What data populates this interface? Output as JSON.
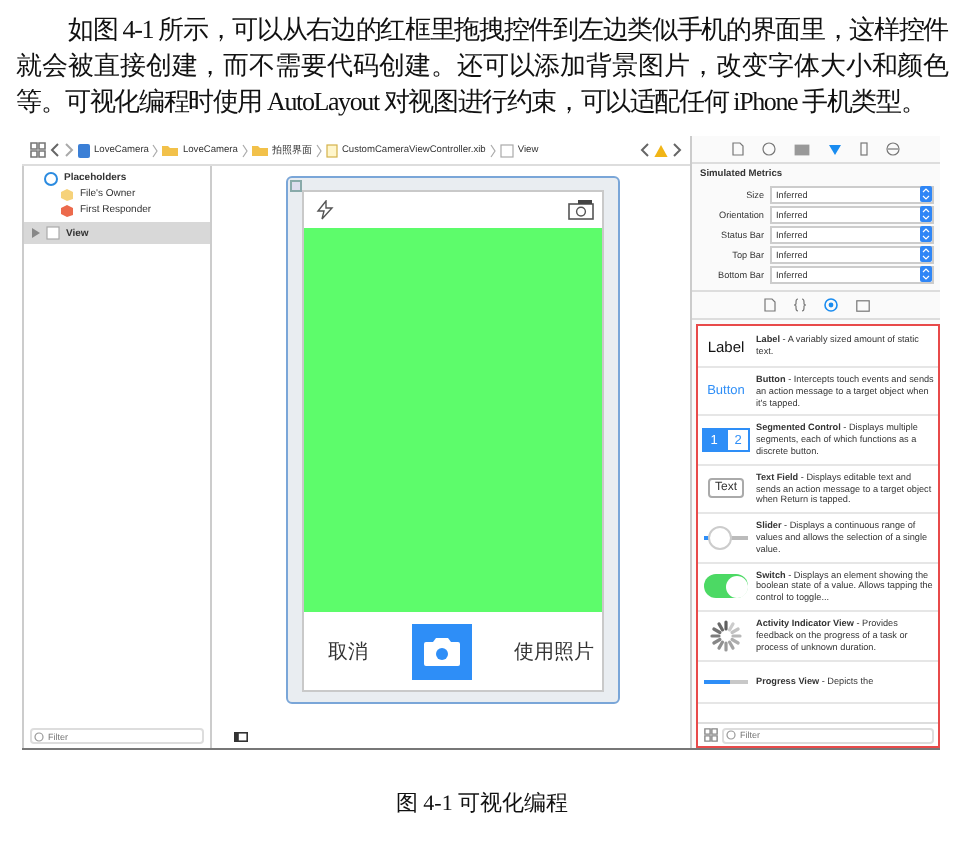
{
  "body_text": "如图 4-1 所示，可以从右边的红框里拖拽控件到左边类似手机的界面里，这样控件就会被直接创建，而不需要代码创建。还可以添加背景图片，改变字体大小和颜色等。可视化编程时使用 AutoLayout 对视图进行约束，可以适配任何 iPhone 手机类型。",
  "breadcrumbs": [
    "LoveCamera",
    "LoveCamera",
    "拍照界面",
    "CustomCameraViewController.xib",
    "View"
  ],
  "outline": [
    {
      "label": "Placeholders",
      "children": [
        {
          "label": "File's Owner",
          "selected": false
        },
        {
          "label": "First Responder",
          "selected": false
        }
      ]
    },
    {
      "label": "View",
      "expanded": false,
      "selected": true
    }
  ],
  "outline_filter": {
    "placeholder": "Filter"
  },
  "phone": {
    "cancel_label": "取消",
    "use_label": "使用照片"
  },
  "inspector": {
    "title": "Simulated Metrics",
    "fields": [
      {
        "label": "Size",
        "value": "Inferred"
      },
      {
        "label": "Orientation",
        "value": "Inferred"
      },
      {
        "label": "Status Bar",
        "value": "Inferred"
      },
      {
        "label": "Top Bar",
        "value": "Inferred"
      },
      {
        "label": "Bottom Bar",
        "value": "Inferred"
      }
    ]
  },
  "library": {
    "items": [
      {
        "kind": "label",
        "sample": "Label",
        "text": "**Label** - A variably sized amount of static text."
      },
      {
        "kind": "button",
        "sample": "Button",
        "text": "**Button** - Intercepts touch events and sends an action message to a target object when it's tapped."
      },
      {
        "kind": "segmented",
        "segments": [
          "1",
          "2"
        ],
        "text": "**Segmented Control** - Displays multiple segments, each of which functions as a discrete button."
      },
      {
        "kind": "textfield",
        "sample": "Text",
        "text": "**Text Field** - Displays editable text and sends an action message to a target object when Return is tapped."
      },
      {
        "kind": "slider",
        "level": 0.2,
        "text": "**Slider** - Displays a continuous range of values and allows the selection of a single value."
      },
      {
        "kind": "switch",
        "on": true,
        "text": "**Switch** - Displays an element showing the boolean state of a value. Allows tapping the control to toggle..."
      },
      {
        "kind": "activity",
        "text": "**Activity Indicator View** - Provides feedback on the progress of a task or process of unknown duration."
      },
      {
        "kind": "progress",
        "level": 0.6,
        "text": "**Progress View** - Depicts the"
      }
    ],
    "filter": {
      "placeholder": "Filter"
    }
  },
  "caption": "图 4-1 可视化编程"
}
